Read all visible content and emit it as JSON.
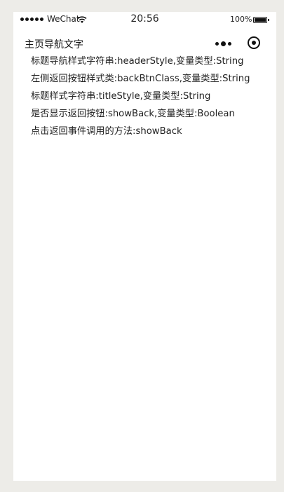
{
  "status_bar": {
    "carrier": "WeChat",
    "time": "20:56",
    "battery_percent": "100%",
    "battery_level": 1.0
  },
  "nav_bar": {
    "title": "主页导航文字",
    "more_icon": "more-dots-icon",
    "target_icon": "target-icon"
  },
  "content": {
    "lines": [
      "标题导航样式字符串:headerStyle,变量类型:String",
      "左侧返回按钮样式类:backBtnClass,变量类型:String",
      "标题样式字符串:titleStyle,变量类型:String",
      "是否显示返回按钮:showBack,变量类型:Boolean",
      "点击返回事件调用的方法:showBack"
    ]
  },
  "colors": {
    "page_background": "#edece8",
    "screen_background": "#ffffff",
    "text": "#222222"
  }
}
